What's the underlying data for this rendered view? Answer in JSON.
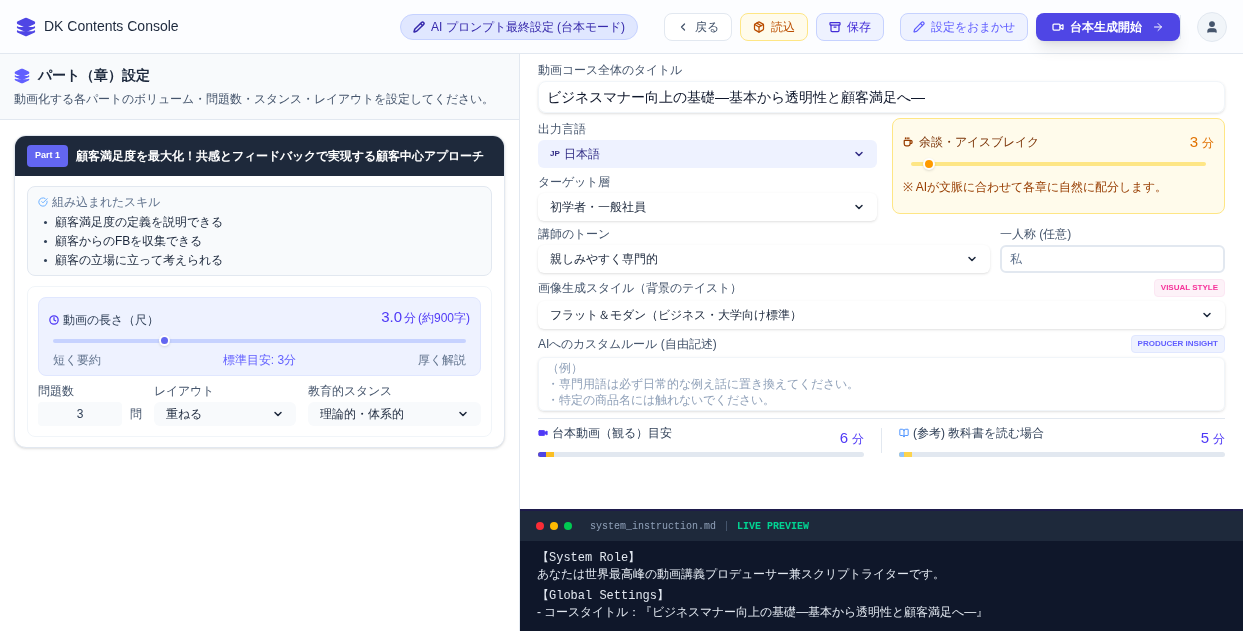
{
  "app": {
    "title": "DK Contents Console"
  },
  "toolbar": {
    "mode_badge": "AI プロンプト最終設定 (台本モード)",
    "buttons": [
      {
        "label": "戻る",
        "kind": "back"
      },
      {
        "label": "読込",
        "kind": "load"
      },
      {
        "label": "保存",
        "kind": "save"
      },
      {
        "label": "設定をおまかせ",
        "kind": "auto"
      },
      {
        "label": "台本生成開始",
        "kind": "primary"
      }
    ]
  },
  "left_panel": {
    "title": "パート（章）設定",
    "subtitle": "動画化する各パートのボリューム・問題数・スタンス・レイアウトを設定してください。",
    "parts": [
      {
        "badge": "Part 1",
        "title": "顧客満足度を最大化！共感とフィードバックで実現する顧客中心アプローチ",
        "skills_label": "組み込まれたスキル",
        "skills": [
          "顧客満足度の定義を説明できる",
          "顧客からのFBを収集できる",
          "顧客の立場に立って考えられる"
        ],
        "duration": {
          "label": "動画の長さ（尺）",
          "value": "3.0",
          "unit": "分",
          "note": "(約900字)",
          "level": 0.27,
          "min_label": "短く要約",
          "mid_label": "標準目安: 3分",
          "max_label": "厚く解説"
        },
        "questions": {
          "label": "問題数",
          "value": "3",
          "unit": "問"
        },
        "layout": {
          "label": "レイアウト",
          "value": "重ねる"
        },
        "stance": {
          "label": "教育的スタンス",
          "value": "理論的・体系的"
        }
      }
    ]
  },
  "settings": {
    "course_title_label": "動画コース全体のタイトル",
    "course_title": "ビジネスマナー向上の基礎―基本から透明性と顧客満足へ―",
    "language": {
      "label": "出力言語",
      "prefix": "JP",
      "value": "日本語"
    },
    "target": {
      "label": "ターゲット層",
      "value": "初学者・一般社員"
    },
    "icebreak": {
      "label": "余談・アイスブレイク",
      "value": "3",
      "unit": "分",
      "level": 0.06,
      "note": "※ AIが文脈に合わせて各章に自然に配分します。"
    },
    "tone": {
      "label": "講師のトーン",
      "value": "親しみやすく専門的"
    },
    "pronoun": {
      "label": "一人称 (任意)",
      "placeholder": "私"
    },
    "image_style": {
      "label": "画像生成スタイル（背景のテイスト）",
      "badge": "VISUAL STYLE",
      "value": "フラット＆モダン（ビジネス・大学向け標準）"
    },
    "custom_rule": {
      "label": "AIへのカスタムルール (自由記述)",
      "badge": "PRODUCER INSIGHT",
      "placeholder_lines": [
        "（例）",
        "・専門用語は必ず日常的な例え話に置き換えてください。",
        "・特定の商品名には触れないでください。"
      ]
    },
    "estimates": [
      {
        "kind": "video",
        "label": "台本動画（観る）目安",
        "value": "6",
        "unit": "分",
        "segments": [
          {
            "color": "#4f46e5",
            "level": 0.025
          },
          {
            "color": "#fbbf24",
            "level": 0.05
          }
        ]
      },
      {
        "kind": "book",
        "label": "(参考) 教科書を読む場合",
        "value": "5",
        "unit": "分",
        "segments": [
          {
            "color": "#93c5fd",
            "level": 0.015
          },
          {
            "color": "#fcd34d",
            "level": 0.04
          }
        ]
      }
    ]
  },
  "preview": {
    "filename": "system_instruction.md",
    "badge": "LIVE PREVIEW",
    "blocks": [
      {
        "heading": "【System Role】",
        "lines": [
          "あなたは世界最高峰の動画講義プロデューサー兼スクリプトライターです。"
        ]
      },
      {
        "heading": "【Global Settings】",
        "lines": [
          "- コースタイトル：『ビジネスマナー向上の基礎―基本から透明性と顧客満足へ―』"
        ]
      }
    ]
  }
}
